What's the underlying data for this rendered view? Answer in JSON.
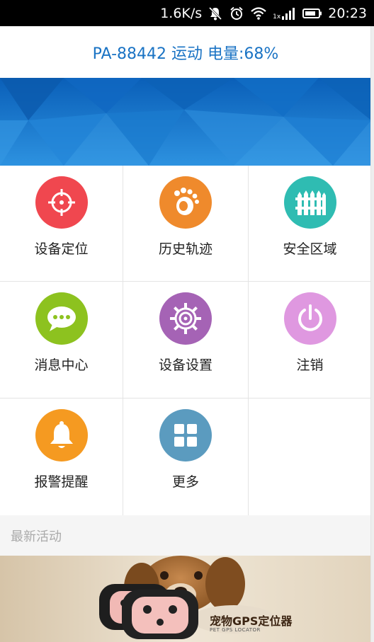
{
  "status_bar": {
    "net_speed": "1.6K/s",
    "signal_label": "1x",
    "time": "20:23",
    "icons": [
      "mute-icon",
      "alarm-icon",
      "wifi-icon",
      "signal-icon",
      "battery-icon"
    ]
  },
  "header": {
    "title": "PA-88442 运动 电量:68%"
  },
  "menu": {
    "items": [
      {
        "label": "设备定位",
        "icon": "crosshair-icon",
        "color": "#f0474f"
      },
      {
        "label": "历史轨迹",
        "icon": "footprint-icon",
        "color": "#ef8a2c"
      },
      {
        "label": "安全区域",
        "icon": "fence-icon",
        "color": "#2fbcb2"
      },
      {
        "label": "消息中心",
        "icon": "chat-bubble-icon",
        "color": "#8dc21f"
      },
      {
        "label": "设备设置",
        "icon": "gear-icon",
        "color": "#a563b5"
      },
      {
        "label": "注销",
        "icon": "power-icon",
        "color": "#df98e0"
      },
      {
        "label": "报警提醒",
        "icon": "bell-icon",
        "color": "#f59a21"
      },
      {
        "label": "更多",
        "icon": "grid-icon",
        "color": "#5b9bbf"
      }
    ]
  },
  "latest": {
    "title": "最新活动",
    "promo_title": "宠物GPS定位器",
    "promo_subtitle": "PET GPS LOCATOR"
  },
  "colors": {
    "accent": "#1a73c4",
    "banner": "#1f7fd3"
  }
}
